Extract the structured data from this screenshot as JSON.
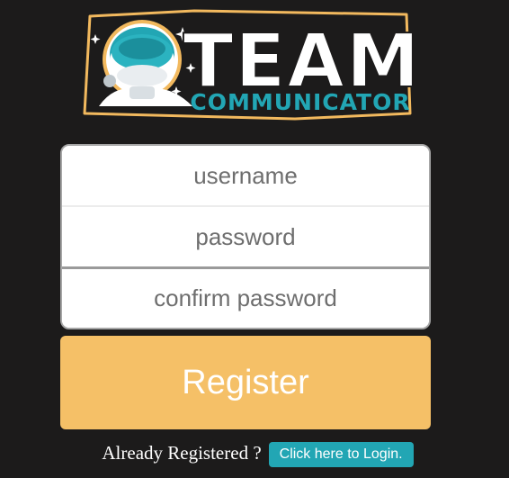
{
  "logo": {
    "title": "TEAM",
    "subtitle": "COMMUNICATOR"
  },
  "form": {
    "username_placeholder": "username",
    "password_placeholder": "password",
    "confirm_placeholder": "confirm password"
  },
  "register_label": "Register",
  "login": {
    "prompt": "Already Registered ?",
    "link_label": "Click here to Login."
  },
  "colors": {
    "background": "#1c1b1b",
    "register_button": "#f5c067",
    "login_button": "#22a6b4",
    "logo_border": "#f2b95e",
    "logo_accent": "#22a6b4"
  }
}
